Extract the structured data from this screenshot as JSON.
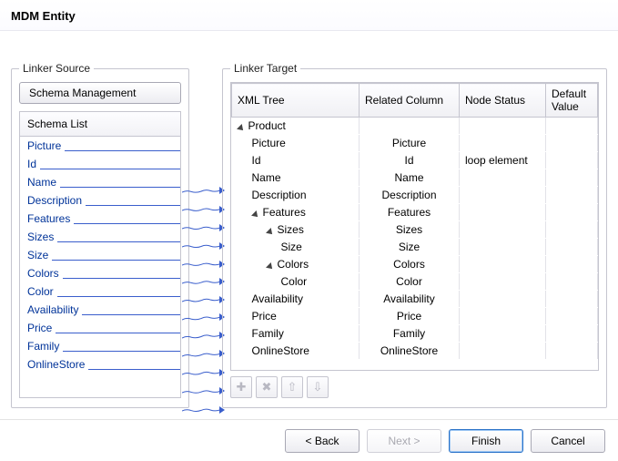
{
  "title": "MDM Entity",
  "linker_source": {
    "legend": "Linker Source",
    "schema_mgmt_label": "Schema Management",
    "list_header": "Schema List",
    "items": [
      "Picture",
      "Id",
      "Name",
      "Description",
      "Features",
      "Sizes",
      "Size",
      "Colors",
      "Color",
      "Availability",
      "Price",
      "Family",
      "OnlineStore"
    ]
  },
  "linker_target": {
    "legend": "Linker Target",
    "columns": [
      "XML Tree",
      "Related Column",
      "Node Status",
      "Default Value"
    ],
    "rows": [
      {
        "indent": 0,
        "expander": true,
        "label": "Product",
        "related": "",
        "status": "",
        "default": ""
      },
      {
        "indent": 1,
        "expander": false,
        "label": "Picture",
        "related": "Picture",
        "status": "",
        "default": ""
      },
      {
        "indent": 1,
        "expander": false,
        "label": "Id",
        "related": "Id",
        "status": "loop element",
        "default": ""
      },
      {
        "indent": 1,
        "expander": false,
        "label": "Name",
        "related": "Name",
        "status": "",
        "default": ""
      },
      {
        "indent": 1,
        "expander": false,
        "label": "Description",
        "related": "Description",
        "status": "",
        "default": ""
      },
      {
        "indent": 1,
        "expander": true,
        "label": "Features",
        "related": "Features",
        "status": "",
        "default": ""
      },
      {
        "indent": 2,
        "expander": true,
        "label": "Sizes",
        "related": "Sizes",
        "status": "",
        "default": ""
      },
      {
        "indent": 3,
        "expander": false,
        "label": "Size",
        "related": "Size",
        "status": "",
        "default": ""
      },
      {
        "indent": 2,
        "expander": true,
        "label": "Colors",
        "related": "Colors",
        "status": "",
        "default": ""
      },
      {
        "indent": 3,
        "expander": false,
        "label": "Color",
        "related": "Color",
        "status": "",
        "default": ""
      },
      {
        "indent": 1,
        "expander": false,
        "label": "Availability",
        "related": "Availability",
        "status": "",
        "default": ""
      },
      {
        "indent": 1,
        "expander": false,
        "label": "Price",
        "related": "Price",
        "status": "",
        "default": ""
      },
      {
        "indent": 1,
        "expander": false,
        "label": "Family",
        "related": "Family",
        "status": "",
        "default": ""
      },
      {
        "indent": 1,
        "expander": false,
        "label": "OnlineStore",
        "related": "OnlineStore",
        "status": "",
        "default": ""
      }
    ],
    "tool_icons": [
      "add",
      "delete",
      "move-up",
      "move-down"
    ]
  },
  "footer": {
    "back": "< Back",
    "next": "Next >",
    "finish": "Finish",
    "cancel": "Cancel"
  }
}
